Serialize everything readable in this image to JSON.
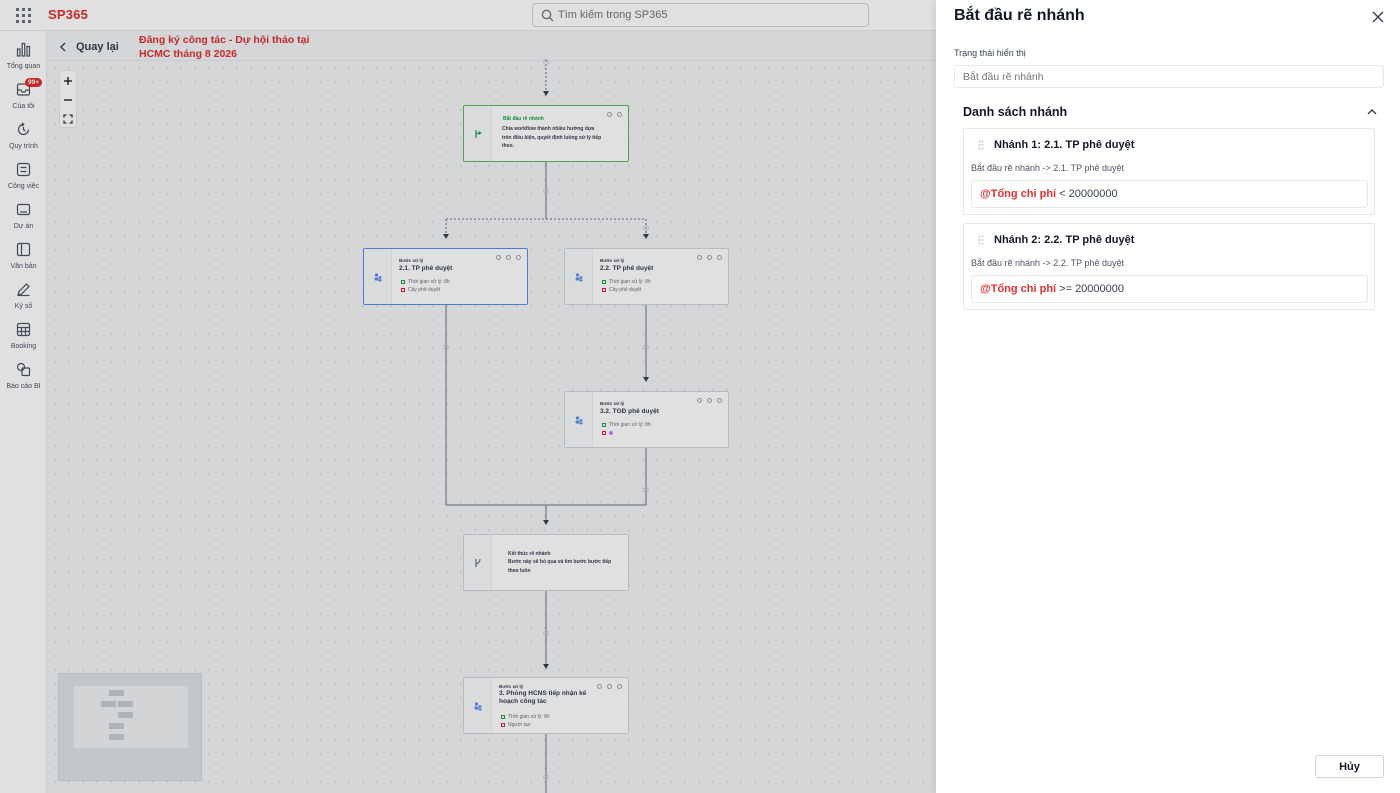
{
  "app": {
    "brand": "SP365",
    "search_placeholder": "Tìm kiếm trong SP365"
  },
  "nav": {
    "items": [
      {
        "label": "Tổng quan",
        "icon": "chart-icon"
      },
      {
        "label": "Của tôi",
        "icon": "inbox-icon",
        "badge": "99+"
      },
      {
        "label": "Quy trình",
        "icon": "process-icon"
      },
      {
        "label": "Công việc",
        "icon": "task-icon"
      },
      {
        "label": "Dự án",
        "icon": "project-icon"
      },
      {
        "label": "Văn bản",
        "icon": "document-icon"
      },
      {
        "label": "Ký số",
        "icon": "pen-icon"
      },
      {
        "label": "Booking",
        "icon": "calendar-icon"
      },
      {
        "label": "Báo cáo BI",
        "icon": "report-icon"
      }
    ]
  },
  "subheader": {
    "back_label": "Quay lại",
    "title": "Đăng ký công tác - Dự hội thảo tại HCMC tháng 8 2026"
  },
  "flow": {
    "start_branch": {
      "name": "Bắt đầu rẽ nhánh",
      "desc": "Chia workflow thành nhiều hướng dựa trên điều kiện, quyết định luồng xử lý tiếp theo."
    },
    "step_21": {
      "kind": "Bước xử lý",
      "name": "2.1. TP phê duyệt",
      "time": "Thời gian xử lý: 8h",
      "assignee": "Cây phê duyệt"
    },
    "step_22": {
      "kind": "Bước xử lý",
      "name": "2.2. TP phê duyệt",
      "time": "Thời gian xử lý: 8h",
      "assignee": "Cây phê duyệt"
    },
    "step_32": {
      "kind": "Bước xử lý",
      "name": "3.2. TGĐ phê duyệt",
      "time": "Thời gian xử lý: 8h"
    },
    "end_branch": {
      "name": "Kết thúc rẽ nhánh",
      "desc": "Bước này sẽ bỏ qua và tìm bước bước tiếp theo luôn"
    },
    "step_3": {
      "kind": "Bước xử lý",
      "name": "3. Phòng HCNS tiếp nhận kế hoạch công tác",
      "time": "Thời gian xử lý: 8h",
      "assignee": "Người tạo"
    }
  },
  "panel": {
    "title": "Bắt đầu rẽ nhánh",
    "display_label": "Trạng thái hiển thị",
    "display_placeholder": "Bắt đầu rẽ nhánh",
    "section_title": "Danh sách nhánh",
    "branches": [
      {
        "title": "Nhánh 1: 2.1. TP phê duyệt",
        "route": "Bắt đầu rẽ nhánh -> 2.1. TP phê duyệt",
        "cond_var": "@Tổng chi phí",
        "cond_expr": " < 20000000"
      },
      {
        "title": "Nhánh 2: 2.2. TP phê duyệt",
        "route": "Bắt đầu rẽ nhánh -> 2.2. TP phê duyệt",
        "cond_var": "@Tổng chi phí",
        "cond_expr": " >= 20000000"
      }
    ],
    "cancel_label": "Hủy"
  },
  "colors": {
    "brand": "#e0302f",
    "start_node_border": "#5cb85c",
    "selected_node_border": "#5b8def"
  }
}
